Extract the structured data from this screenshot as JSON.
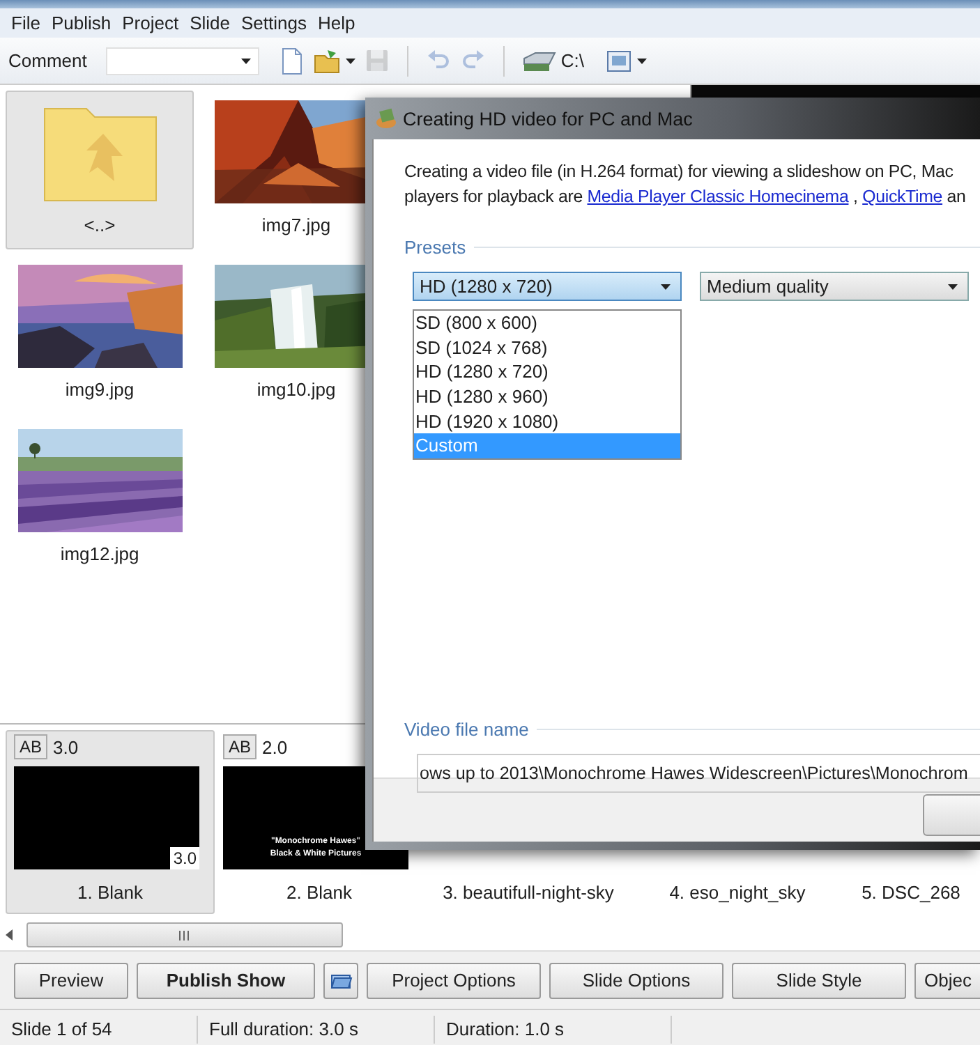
{
  "menu": [
    "File",
    "Publish",
    "Project",
    "Slide",
    "Settings",
    "Help"
  ],
  "toolbar": {
    "comment_label": "Comment",
    "drive": "C:\\",
    "buttons": [
      {
        "kind": "new",
        "disabled": false
      },
      {
        "kind": "open",
        "disabled": false
      },
      {
        "kind": "save",
        "disabled": true
      },
      {
        "kind": "undo",
        "disabled": true
      },
      {
        "kind": "redo",
        "disabled": true
      }
    ]
  },
  "files": [
    {
      "name": "<..>",
      "kind": "folder",
      "selected": true
    },
    {
      "name": "img7.jpg",
      "kind": "picture",
      "selected": false
    },
    {
      "name": "img9.jpg",
      "kind": "picture",
      "selected": false
    },
    {
      "name": "img10.jpg",
      "kind": "picture",
      "selected": false
    },
    {
      "name": "img12.jpg",
      "kind": "picture",
      "selected": false
    }
  ],
  "dialog": {
    "title": "Creating HD video for PC and Mac",
    "description": [
      {
        "kind": "text",
        "text": "Creating a video file (in H.264 format) for viewing a slideshow on PC, Mac"
      },
      {
        "kind": "break"
      },
      {
        "kind": "text",
        "text": "players for playback are "
      },
      {
        "kind": "link",
        "text": "Media Player Classic Homecinema"
      },
      {
        "kind": "text",
        "text": " , "
      },
      {
        "kind": "link",
        "text": "QuickTime"
      },
      {
        "kind": "text",
        "text": " an"
      }
    ],
    "presets_label": "Presets",
    "preset": "HD (1280 x 720)",
    "quality": "Medium quality",
    "preset_options": [
      {
        "label": "SD (800 x 600)",
        "selected": false
      },
      {
        "label": "SD (1024 x 768)",
        "selected": false
      },
      {
        "label": "HD (1280 x 720)",
        "selected": false
      },
      {
        "label": "HD (1280 x 960)",
        "selected": false
      },
      {
        "label": "HD (1920 x 1080)",
        "selected": false
      },
      {
        "label": "Custom",
        "selected": true
      }
    ],
    "video_file_label": "Video file name",
    "video_file": "ows up to 2013\\Monochrome Hawes Widescreen\\Pictures\\Monochrom"
  },
  "slides": [
    {
      "label": "1. Blank",
      "selected": true,
      "effect": "AB",
      "duration": "3.0",
      "badge": "3.0"
    },
    {
      "label": "2. Blank",
      "selected": false,
      "effect": "AB",
      "duration": "2.0",
      "thumb_lines": [
        "\"Monochrome Hawes\"",
        "Black & White Pictures"
      ]
    },
    {
      "label": "3. beautifull-night-sky",
      "selected": false
    },
    {
      "label": "4. eso_night_sky",
      "selected": false
    },
    {
      "label": "5. DSC_268",
      "selected": false
    }
  ],
  "buttons": [
    {
      "kind": "text",
      "label": "Preview"
    },
    {
      "kind": "primary",
      "label": "Publish Show"
    },
    {
      "kind": "icon"
    },
    {
      "kind": "text",
      "label": "Project Options"
    },
    {
      "kind": "text",
      "label": "Slide Options"
    },
    {
      "kind": "text",
      "label": "Slide Style"
    },
    {
      "kind": "text",
      "label": "Objec"
    }
  ],
  "status": [
    "Slide 1 of 54",
    "Full duration: 3.0 s",
    "Duration: 1.0 s"
  ]
}
